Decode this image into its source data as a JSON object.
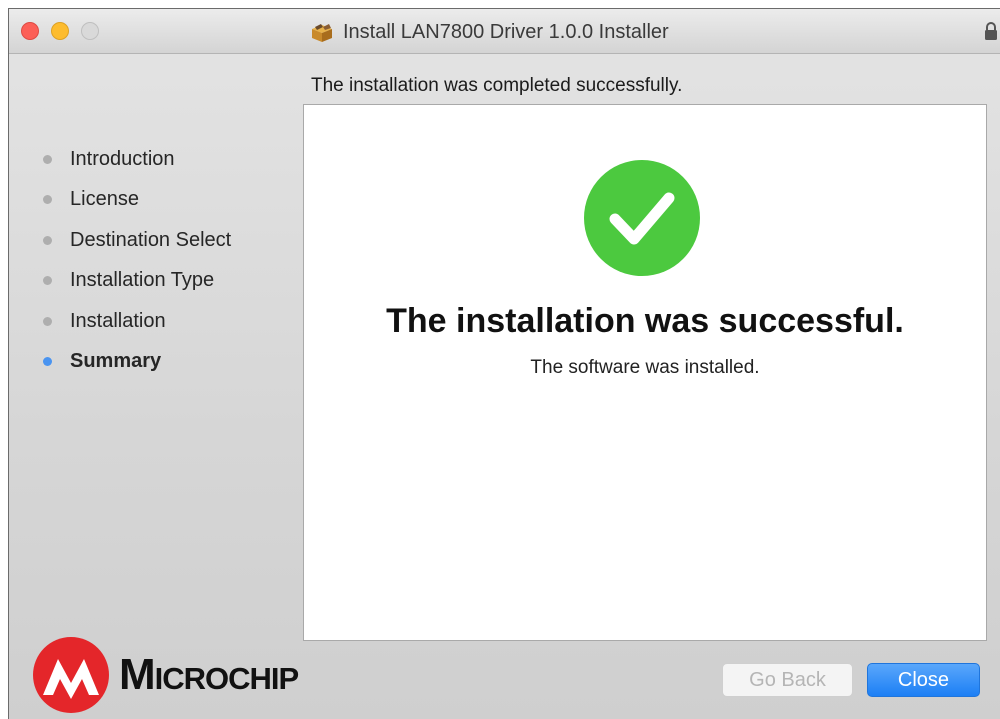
{
  "window": {
    "title": "Install LAN7800 Driver 1.0.0 Installer",
    "header_message": "The installation was completed successfully."
  },
  "sidebar": {
    "steps": [
      {
        "label": "Introduction",
        "active": false
      },
      {
        "label": "License",
        "active": false
      },
      {
        "label": "Destination Select",
        "active": false
      },
      {
        "label": "Installation Type",
        "active": false
      },
      {
        "label": "Installation",
        "active": false
      },
      {
        "label": "Summary",
        "active": true
      }
    ]
  },
  "content": {
    "title": "The installation was successful.",
    "subtitle": "The software was installed."
  },
  "brand": {
    "name": "Microchip"
  },
  "buttons": {
    "back_label": "Go Back",
    "close_label": "Close"
  },
  "icons": {
    "titlebar": "package-icon",
    "lock": "lock-icon",
    "success": "checkmark-icon",
    "logo": "microchip-logo-icon"
  },
  "colors": {
    "accent": "#1c7ff5",
    "success_green": "#4cc93f",
    "logo_red": "#e4262a",
    "active_step": "#4a94f0"
  }
}
